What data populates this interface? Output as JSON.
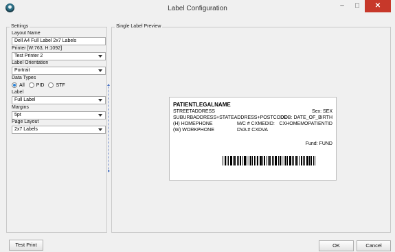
{
  "window": {
    "title": "Label Configuration",
    "minimize_glyph": "–",
    "maximize_glyph": "□",
    "close_glyph": "✕"
  },
  "settings": {
    "group_title": "Settings",
    "layout_name_label": "Layout Name",
    "layout_name_value": "Dell A4 Full Label 2x7 Labels",
    "printer_label": "Printer [W:763, H:1092]",
    "printer_value": "Test Printer 2",
    "orientation_label": "Label Orientation",
    "orientation_value": "Portrait",
    "data_types_label": "Data Types",
    "data_types": [
      {
        "label": "All",
        "selected": true
      },
      {
        "label": "PID",
        "selected": false
      },
      {
        "label": "STF",
        "selected": false
      }
    ],
    "label_label": "Label",
    "label_value": "Full Label",
    "margins_label": "Margins",
    "margins_value": "5pt",
    "page_layout_label": "Page Layout",
    "page_layout_value": "2x7 Labels"
  },
  "preview": {
    "group_title": "Single Label Preview",
    "patient_name": "PATIENTLEGALNAME",
    "street_address": "STREETADDRESS",
    "sex": "Sex: SEX",
    "suburb_line": "SUBURBADDRESS+STATEADDRESS+POSTCODE",
    "dob": "DOB: DATE_OF_BIRTH",
    "home_phone": "(H) HOMEPHONE",
    "medicare": "M/C # CXMEDID:",
    "home_patient_id": "CXHOMEMOPATIENTID",
    "work_phone": "(W) WORKPHONE",
    "dva": "DVA # CXDVA",
    "fund": "Fund: FUND"
  },
  "buttons": {
    "test_print": "Test Print",
    "ok": "OK",
    "cancel": "Cancel"
  }
}
